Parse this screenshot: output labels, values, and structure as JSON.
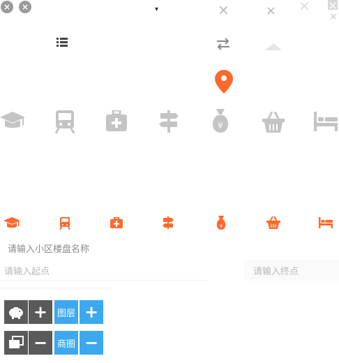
{
  "top": {
    "close_glyph": "×",
    "dropdown_glyph": "▾",
    "list_icon": "list-icon",
    "swap_icon": "swap-arrows-icon",
    "location_icon": "location-pin-icon",
    "up_icon": "caret-up-icon"
  },
  "categories": {
    "items": [
      {
        "name": "education",
        "icon": "graduation-cap-icon"
      },
      {
        "name": "subway",
        "icon": "subway-train-icon"
      },
      {
        "name": "hospital",
        "icon": "medical-kit-icon"
      },
      {
        "name": "signpost",
        "icon": "signpost-icon"
      },
      {
        "name": "bank",
        "icon": "money-bag-icon"
      },
      {
        "name": "shopping",
        "icon": "basket-icon"
      },
      {
        "name": "hotel",
        "icon": "bed-icon"
      }
    ],
    "gray_color": "#c4c4c4",
    "orange_color": "#ff6a2c"
  },
  "search": {
    "community_placeholder": "请输入小区楼盘名称",
    "start_placeholder": "请输入起点",
    "end_placeholder": "请输入终点"
  },
  "map_controls": {
    "layers_label": "图层",
    "business_label": "商圈",
    "plus_glyph": "+",
    "minus_glyph": "−"
  }
}
